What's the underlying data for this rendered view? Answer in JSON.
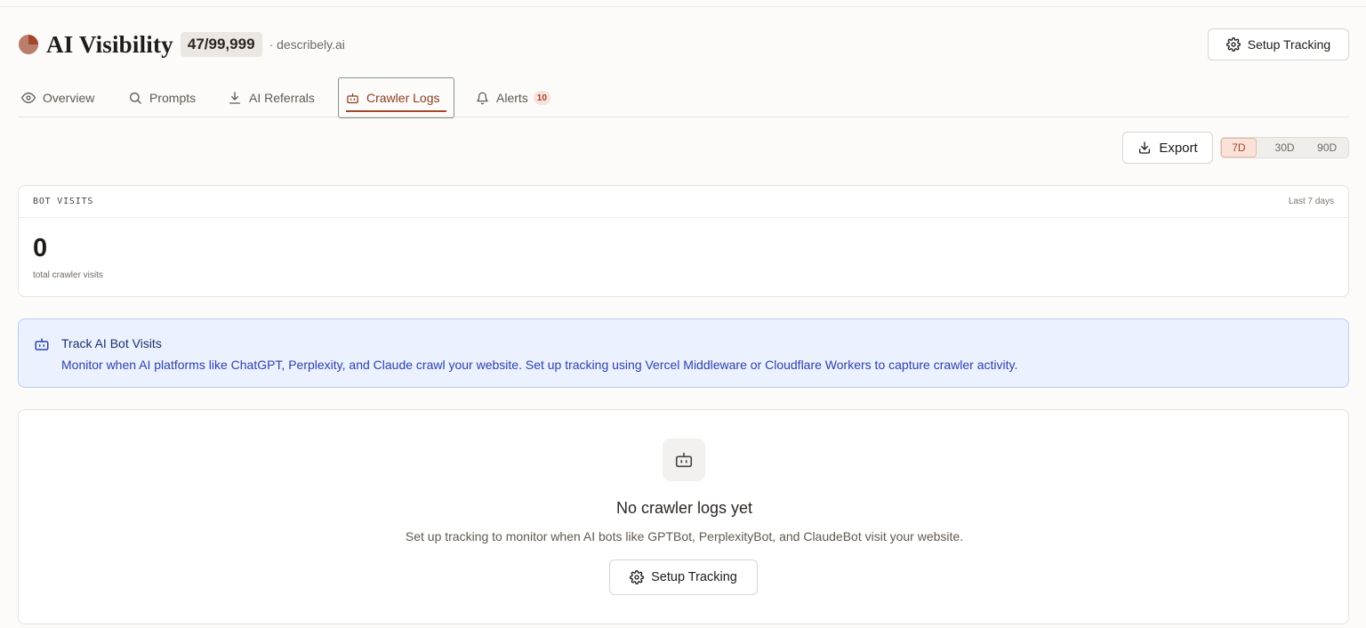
{
  "header": {
    "title": "AI Visibility",
    "count": "47/99,999",
    "domain": "· describely.ai",
    "setup_label": "Setup Tracking"
  },
  "tabs": [
    {
      "label": "Overview",
      "icon": "eye-icon"
    },
    {
      "label": "Prompts",
      "icon": "search-icon"
    },
    {
      "label": "AI Referrals",
      "icon": "download-icon"
    },
    {
      "label": "Crawler Logs",
      "icon": "bot-icon",
      "active": true
    },
    {
      "label": "Alerts",
      "icon": "bell-icon",
      "badge": "10"
    }
  ],
  "toolbar": {
    "export_label": "Export",
    "ranges": [
      "7D",
      "30D",
      "90D"
    ],
    "selected_range": "7D"
  },
  "stats": {
    "label": "BOT VISITS",
    "period": "Last 7 days",
    "value": "0",
    "caption": "total crawler visits"
  },
  "info": {
    "title": "Track AI Bot Visits",
    "text": "Monitor when AI platforms like ChatGPT, Perplexity, and Claude crawl your website. Set up tracking using Vercel Middleware or Cloudflare Workers to capture crawler activity."
  },
  "empty": {
    "title": "No crawler logs yet",
    "text": "Set up tracking to monitor when AI bots like GPTBot, PerplexityBot, and ClaudeBot visit your website.",
    "button_label": "Setup Tracking"
  },
  "colors": {
    "accent": "#a3472a",
    "info_bg": "#ebf1ff",
    "info_text": "#2c42b1"
  }
}
